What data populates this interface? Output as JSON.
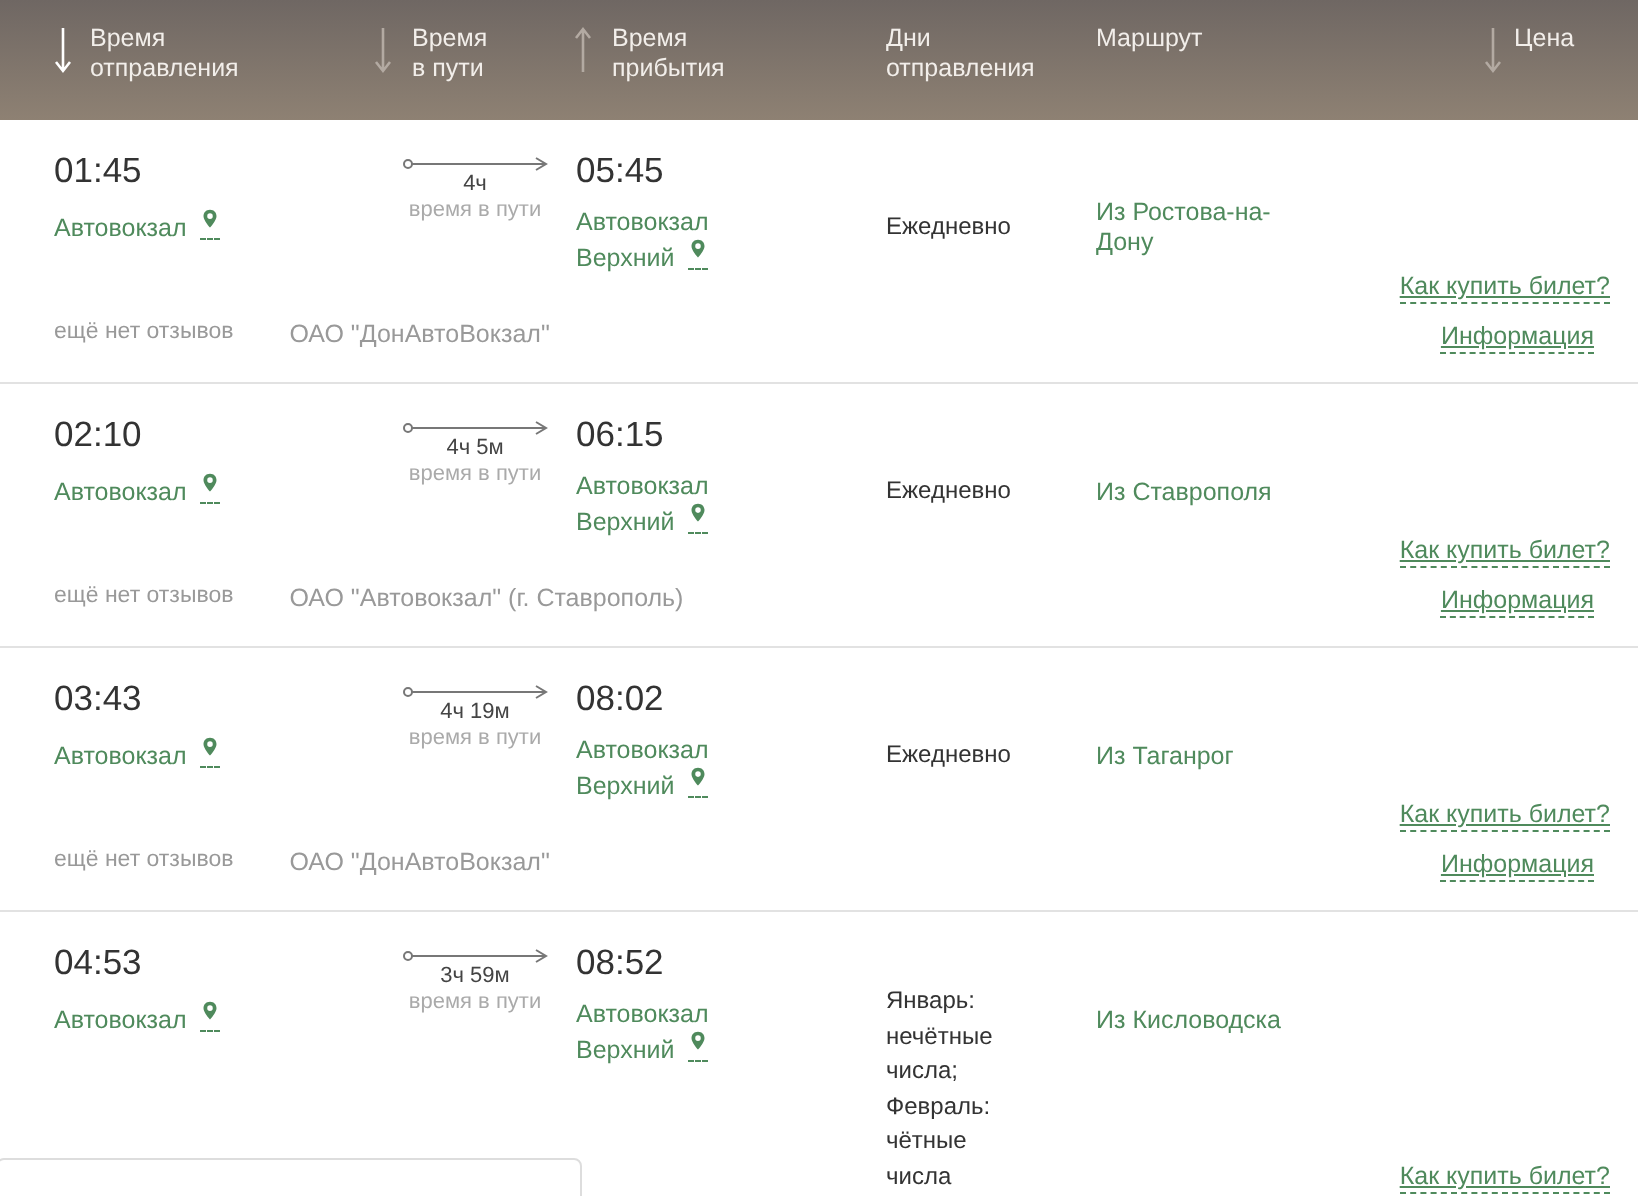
{
  "columns": [
    {
      "label": "Время\nотправления",
      "sortable": true,
      "sort_active": true,
      "ascending": false
    },
    {
      "label": "Время\nв пути",
      "sortable": true,
      "sort_active": false,
      "ascending": false
    },
    {
      "label": "Время\nприбытия",
      "sortable": true,
      "sort_active": false,
      "ascending": true
    },
    {
      "label": "Дни\nотправления",
      "sortable": false
    },
    {
      "label": "Маршрут",
      "sortable": false
    },
    {
      "label": "Цена",
      "sortable": true,
      "sort_active": false,
      "ascending": false
    }
  ],
  "trips": [
    {
      "departure_time": "01:45",
      "departure_station": "Автовокзал",
      "duration": "4ч",
      "duration_caption": "время в пути",
      "arrival_time": "05:45",
      "arrival_station": "Автовокзал Верхний",
      "days": "Ежедневно",
      "route": "Из Ростова-на-Дону",
      "reviews": "ещё нет отзывов",
      "carrier": "ОАО \"ДонАвтоВокзал\"",
      "how_to_buy": "Как купить билет?",
      "info": "Информация"
    },
    {
      "departure_time": "02:10",
      "departure_station": "Автовокзал",
      "duration": "4ч 5м",
      "duration_caption": "время в пути",
      "arrival_time": "06:15",
      "arrival_station": "Автовокзал Верхний",
      "days": "Ежедневно",
      "route": "Из Ставрополя",
      "reviews": "ещё нет отзывов",
      "carrier": "ОАО \"Автовокзал\" (г. Ставрополь)",
      "how_to_buy": "Как купить билет?",
      "info": "Информация"
    },
    {
      "departure_time": "03:43",
      "departure_station": "Автовокзал",
      "duration": "4ч 19м",
      "duration_caption": "время в пути",
      "arrival_time": "08:02",
      "arrival_station": "Автовокзал Верхний",
      "days": "Ежедневно",
      "route": "Из Таганрог",
      "reviews": "ещё нет отзывов",
      "carrier": "ОАО \"ДонАвтоВокзал\"",
      "how_to_buy": "Как купить билет?",
      "info": "Информация"
    },
    {
      "departure_time": "04:53",
      "departure_station": "Автовокзал",
      "duration": "3ч 59м",
      "duration_caption": "время в пути",
      "arrival_time": "08:52",
      "arrival_station": "Автовокзал Верхний",
      "days": "Январь: нечётные числа; Февраль: чётные числа",
      "route": "Из Кисловодска",
      "how_to_buy": "Как купить билет?"
    }
  ]
}
